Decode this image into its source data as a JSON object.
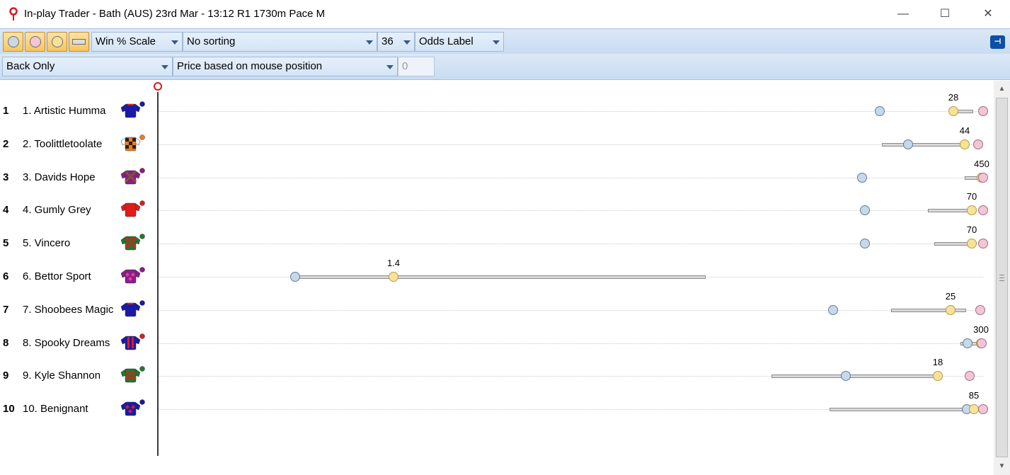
{
  "window": {
    "title": "In-play Trader - Bath (AUS) 23rd Mar - 13:12 R1 1730m Pace M",
    "controls": {
      "minimize": "—",
      "maximize": "☐",
      "close": "✕"
    }
  },
  "toolbar": {
    "scale": "Win % Scale",
    "sorting": "No sorting",
    "size": "36",
    "label": "Odds Label",
    "bet_side": "Back Only",
    "price_mode": "Price based on mouse position",
    "price_value": "0"
  },
  "colors": {
    "back_marker": "#c7d8e8",
    "price_marker": "#f6e29a",
    "lay_marker": "#f2c6d6",
    "winning_post": "#d71a1a"
  },
  "runners": [
    {
      "num": "1",
      "name": "1. Artistic Humma",
      "odds": "28",
      "silks": {
        "body": "#1a1aa6",
        "sleeves": "#1a1aa6",
        "cap": "#1a1aa6",
        "accent": "#e01b1b",
        "pattern": "collar"
      }
    },
    {
      "num": "2",
      "name": "2. Toolittletoolate",
      "odds": "44",
      "silks": {
        "body": "#f07d18",
        "sleeves": "#ffffff",
        "cap": "#f07d18",
        "accent": "#222222",
        "pattern": "check"
      }
    },
    {
      "num": "3",
      "name": "3. Davids Hope",
      "odds": "450",
      "silks": {
        "body": "#8a1d8a",
        "sleeves": "#8a1d8a",
        "cap": "#8a1d8a",
        "accent": "#7a5a2a",
        "pattern": "cross"
      }
    },
    {
      "num": "4",
      "name": "4. Gumly Grey",
      "odds": "70",
      "silks": {
        "body": "#e01b1b",
        "sleeves": "#e01b1b",
        "cap": "#e01b1b",
        "accent": "#b01010",
        "pattern": "plain"
      }
    },
    {
      "num": "5",
      "name": "5. Vincero",
      "odds": "70",
      "silks": {
        "body": "#1f7a2a",
        "sleeves": "#1f7a2a",
        "cap": "#1f7a2a",
        "accent": "#d42020",
        "pattern": "check"
      }
    },
    {
      "num": "6",
      "name": "6. Bettor Sport",
      "odds": "1.4",
      "silks": {
        "body": "#8a1d8a",
        "sleeves": "#8a1d8a",
        "cap": "#8a1d8a",
        "accent": "#e0409a",
        "pattern": "diamonds"
      }
    },
    {
      "num": "7",
      "name": "7. Shoobees Magic",
      "odds": "25",
      "silks": {
        "body": "#1a1aa6",
        "sleeves": "#1a1aa6",
        "cap": "#1a1aa6",
        "accent": "#e01b1b",
        "pattern": "collar"
      }
    },
    {
      "num": "8",
      "name": "8. Spooky Dreams",
      "odds": "300",
      "silks": {
        "body": "#1a1aa6",
        "sleeves": "#1a1aa6",
        "cap": "#e01b1b",
        "accent": "#e01b1b",
        "pattern": "stripes"
      }
    },
    {
      "num": "9",
      "name": "9. Kyle Shannon",
      "odds": "18",
      "silks": {
        "body": "#1f7a2a",
        "sleeves": "#1f7a2a",
        "cap": "#1f7a2a",
        "accent": "#d42020",
        "pattern": "hoops"
      }
    },
    {
      "num": "10",
      "name": "10. Benignant",
      "odds": "85",
      "silks": {
        "body": "#1a1aa6",
        "sleeves": "#1a1aa6",
        "cap": "#1a1aa6",
        "accent": "#d42020",
        "pattern": "diamonds"
      }
    }
  ]
}
